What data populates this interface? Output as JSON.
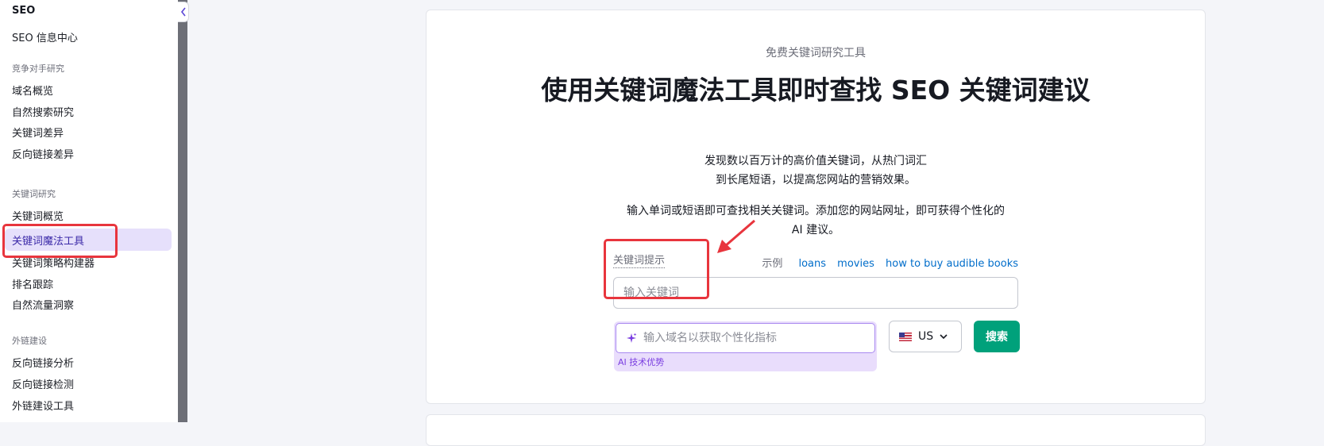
{
  "sidebar": {
    "title": "SEO",
    "items_top": [
      "SEO 信息中心"
    ],
    "sections": [
      {
        "title": "竞争对手研究",
        "items": [
          "域名概览",
          "自然搜索研究",
          "关键词差异",
          "反向链接差异"
        ]
      },
      {
        "title": "关键词研究",
        "items": [
          "关键词概览",
          "关键词魔法工具",
          "关键词策略构建器",
          "排名跟踪",
          "自然流量洞察"
        ]
      },
      {
        "title": "外链建设",
        "items": [
          "反向链接分析",
          "反向链接检测",
          "外链建设工具"
        ]
      }
    ],
    "active_item": "关键词魔法工具"
  },
  "main": {
    "eyebrow": "免费关键词研究工具",
    "heading": "使用关键词魔法工具即时查找 SEO 关键词建议",
    "sub_line1": "发现数以百万计的高价值关键词，从热门词汇",
    "sub_line2": "到长尾短语，以提高您网站的营销效果。",
    "desc_line1": "输入单词或短语即可查找相关关键词。添加您的网站网址，即可获得个性化的",
    "desc_line2": "AI 建议。",
    "hint_label": "关键词提示",
    "examples_label": "示例",
    "examples": [
      "loans",
      "movies",
      "how to buy audible books"
    ],
    "keyword_placeholder": "输入关键词",
    "domain_placeholder": "输入域名以获取个性化指标",
    "ai_label": "AI 技术优势",
    "country": "US",
    "search_button": "搜索"
  },
  "colors": {
    "accent_green": "#00a17b",
    "ai_purple": "#7a3ee0",
    "link_blue": "#006dca",
    "highlight_red": "#e8353d",
    "active_bg": "#e6e0fb"
  },
  "icons": [
    "chevron-left-icon",
    "sparkle-icon",
    "us-flag-icon",
    "chevron-down-icon",
    "arrow-annotation-icon"
  ]
}
